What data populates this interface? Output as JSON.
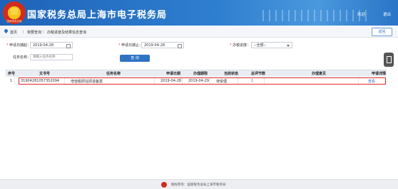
{
  "header": {
    "title": "国家税务总局上海市电子税务局",
    "emblem_text": "国家税务总局",
    "welcome": "欢迎",
    "user_link": "退出"
  },
  "breadcrumb": {
    "home": "首页",
    "level1": "我要查询",
    "level2": "办税进度及结果信息查询",
    "separator": "|"
  },
  "return_button": "返回",
  "filters": {
    "start_date_label": "申请日期起：",
    "start_date_value": "2019-04-28",
    "end_date_label": "申请日期止：",
    "end_date_value": "2019-04-28",
    "status_label": "办税进度：",
    "status_value": "--全部--",
    "task_name_label": "任务名称：",
    "task_name_placeholder": "请输入任务名称",
    "query_button": "查 询"
  },
  "table": {
    "columns": [
      "序号",
      "文书号",
      "任务名称",
      "申请日期",
      "办理期限",
      "当前状态",
      "总评节数",
      "办理意见",
      "申请详情"
    ],
    "rows": [
      {
        "index": "1",
        "doc_no": "31904281057352094",
        "task_name": "增值税即征即退备案",
        "apply_date": "2019-04-28",
        "deadline": "2019-04-29",
        "status": "待受理",
        "count": "1",
        "opinion": "",
        "detail": "查看"
      }
    ]
  },
  "footer": {
    "text": "版权所有：国家税务总局上海市税务局"
  },
  "colors": {
    "header_blue": "#2f7fd0",
    "accent_blue": "#2f73c4",
    "highlight_red": "#e02828"
  }
}
